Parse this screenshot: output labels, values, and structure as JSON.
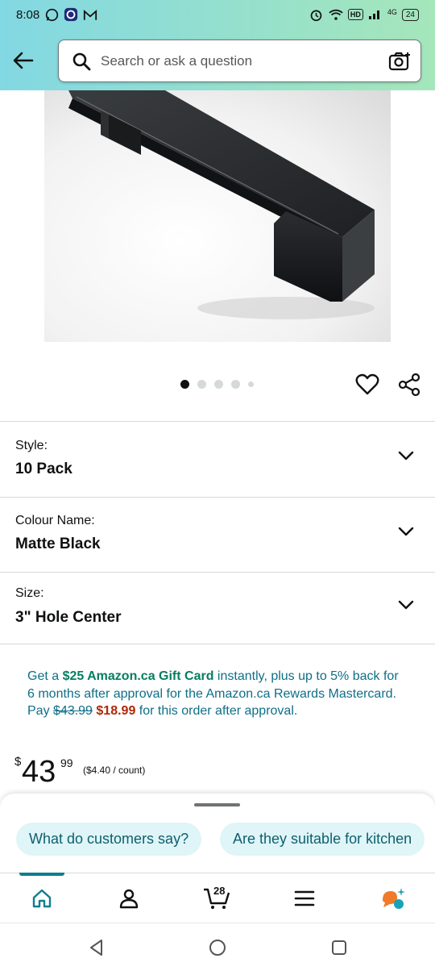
{
  "status_bar": {
    "time": "8:08",
    "network": "4G",
    "battery": "24",
    "hd_label": "HD",
    "icons": [
      "whatsapp-icon",
      "app-icon",
      "gmail-icon",
      "alarm-icon",
      "wifi-icon",
      "signal-icon",
      "battery-icon"
    ]
  },
  "header": {
    "back_icon": "back-arrow-icon",
    "search_placeholder": "Search or ask a question",
    "camera_icon": "camera-search-icon"
  },
  "product": {
    "image_description_icon": "product-image",
    "carousel": {
      "count": 5,
      "active_index": 0
    },
    "actions": [
      "heart-icon",
      "share-icon"
    ]
  },
  "variations": [
    {
      "label": "Style:",
      "value": "10 Pack"
    },
    {
      "label": "Colour Name:",
      "value": "Matte Black"
    },
    {
      "label": "Size:",
      "value": "3\" Hole Center"
    }
  ],
  "promo": {
    "prefix": "Get a ",
    "gift_card": "$25 Amazon.ca Gift Card",
    "middle": " instantly, plus up to 5% back for 6 months after approval for the Amazon.ca Rewards Mastercard.",
    "pay_label": "Pay ",
    "old_price": "$43.99",
    "new_price": "$18.99",
    "suffix": " for this order after approval."
  },
  "price": {
    "symbol": "$",
    "whole": "43",
    "fraction": "99",
    "unit_price": "($4.40 / count)"
  },
  "rufus": {
    "chips": [
      "What do customers say?",
      "Are they suitable for kitchen"
    ]
  },
  "bottom_nav": {
    "items": [
      "home-icon",
      "account-icon",
      "cart-icon",
      "menu-icon",
      "rufus-icon"
    ],
    "cart_count": "28",
    "active": "home",
    "accent": "#0f7e8e"
  },
  "system_nav": [
    "back-triangle-icon",
    "home-circle-icon",
    "recents-square-icon"
  ]
}
